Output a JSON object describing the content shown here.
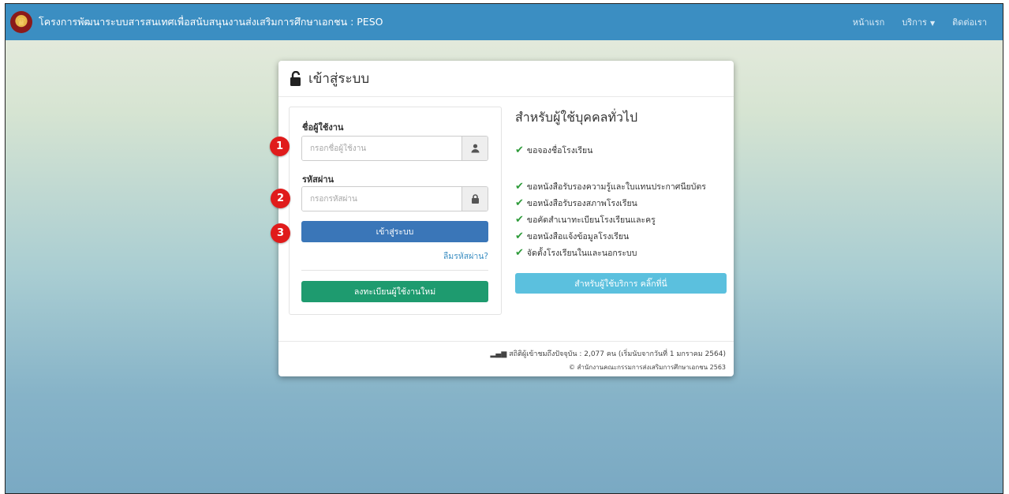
{
  "navbar": {
    "logo_glyph": "♛",
    "brand": "โครงการพัฒนาระบบสารสนเทศเพื่อสนับสนุนงานส่งเสริมการศึกษาเอกชน : PESO",
    "links": [
      "หน้าแรก",
      "บริการ",
      "ติดต่อเรา"
    ]
  },
  "card": {
    "title": "เข้าสู่ระบบ",
    "login": {
      "username_label": "ชื่อผู้ใช้งาน",
      "username_placeholder": "กรอกชื่อผู้ใช้งาน",
      "password_label": "รหัสผ่าน",
      "password_placeholder": "กรอกรหัสผ่าน",
      "login_button": "เข้าสู่ระบบ",
      "forgot_link": "ลืมรหัสผ่าน?",
      "register_button": "ลงทะเบียนผู้ใช้งานใหม่"
    },
    "public": {
      "title": "สำหรับผู้ใช้บุคคลทั่วไป",
      "items": [
        "ขอจองชื่อโรงเรียน",
        "ขอหนังสือรับรองความรู้และใบแทนประกาศนียบัตร",
        "ขอหนังสือรับรองสภาพโรงเรียน",
        "ขอคัดสำเนาทะเบียนโรงเรียนและครู",
        "ขอหนังสือแจ้งข้อมูลโรงเรียน",
        "จัดตั้งโรงเรียนในและนอกระบบ"
      ],
      "service_button": "สำหรับผู้ใช้บริการ คลิ๊กที่นี่"
    },
    "footer": {
      "stats": "สถิติผู้เข้าชมถึงปัจจุบัน : 2,077 คน (เริ่มนับจากวันที่ 1 มกราคม 2564)",
      "copyright": "© สำนักงานคณะกรรมการส่งเสริมการศึกษาเอกชน 2563"
    }
  },
  "annotations": [
    "1",
    "2",
    "3"
  ],
  "colors": {
    "navbar": "#3b8ec2",
    "login_button": "#3a76b8",
    "register_button": "#1e9b6f",
    "service_button": "#5bc0de",
    "annotation_badge": "#e01b1b",
    "check": "#2e9b3a"
  }
}
